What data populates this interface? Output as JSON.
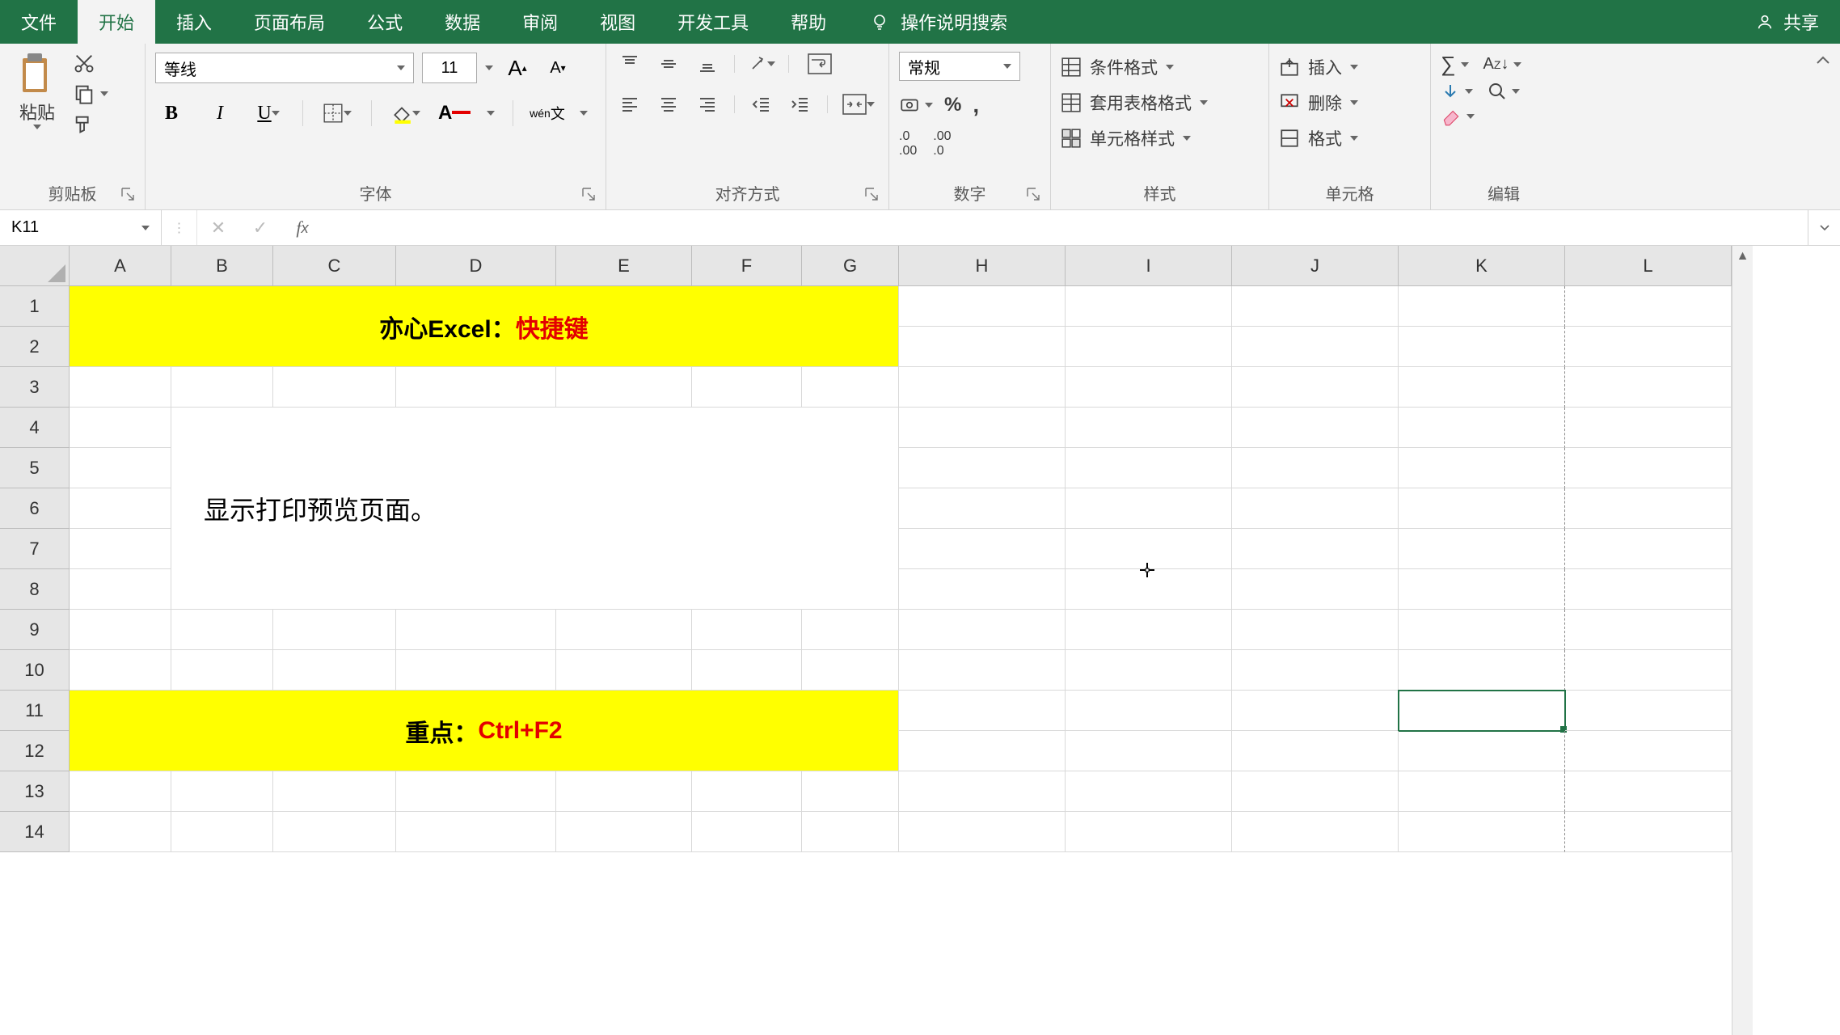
{
  "tabs": {
    "file": "文件",
    "home": "开始",
    "insert": "插入",
    "pagelayout": "页面布局",
    "formulas": "公式",
    "data": "数据",
    "review": "审阅",
    "view": "视图",
    "developer": "开发工具",
    "help": "帮助"
  },
  "tellme": "操作说明搜索",
  "share": "共享",
  "ribbon": {
    "clipboard": {
      "paste": "粘贴",
      "label": "剪贴板"
    },
    "font": {
      "name": "等线",
      "size": "11",
      "label": "字体"
    },
    "alignment": {
      "label": "对齐方式"
    },
    "number": {
      "format": "常规",
      "label": "数字"
    },
    "styles": {
      "conditional": "条件格式",
      "formatTable": "套用表格格式",
      "cellStyles": "单元格样式",
      "label": "样式"
    },
    "cells": {
      "insert": "插入",
      "delete": "删除",
      "format": "格式",
      "label": "单元格"
    },
    "editing": {
      "label": "编辑"
    }
  },
  "namebox": "K11",
  "formula": "",
  "columns": [
    "A",
    "B",
    "C",
    "D",
    "E",
    "F",
    "G",
    "H",
    "I",
    "J",
    "K",
    "L"
  ],
  "rows": [
    "1",
    "2",
    "3",
    "4",
    "5",
    "6",
    "7",
    "8",
    "9",
    "10",
    "11",
    "12",
    "13",
    "14"
  ],
  "content": {
    "title_black": "亦心Excel：",
    "title_red": "快捷键",
    "body": "显示打印预览页面。",
    "footer_black": "重点：",
    "footer_red": "Ctrl+F2"
  },
  "selected_cell": "K11"
}
